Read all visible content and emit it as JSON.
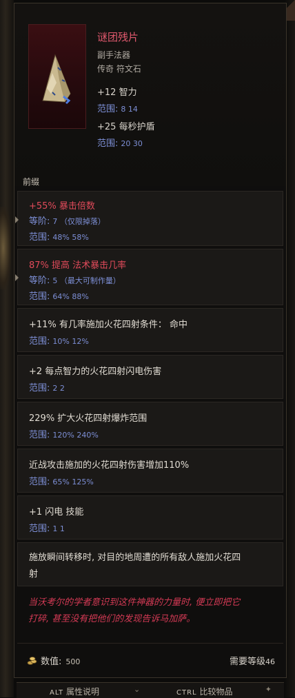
{
  "item": {
    "name": "谜团残片",
    "type": "副手法器",
    "rarity": "传奇 符文石",
    "base_stats": [
      {
        "text": "+12 智力",
        "range_label": "范围:",
        "range": "8 14"
      },
      {
        "text": "+25 每秒护盾",
        "range_label": "范围:",
        "range": "20 30"
      }
    ]
  },
  "prefix_label": "前缀",
  "affixes": [
    {
      "line1": "+55% 暴击倍数",
      "line2_label": "等阶:",
      "line2": "7 （仅限掉落）",
      "range_label": "范围:",
      "range": "48% 58%"
    },
    {
      "line1": "87% 提高 法术暴击几率",
      "line2_label": "等阶:",
      "line2": "5 （最大可制作量）",
      "range_label": "范围:",
      "range": "64% 88%"
    },
    {
      "line1": "+11% 有几率施加火花四射条件： 命中",
      "range_label": "范围:",
      "range": "10% 12%"
    },
    {
      "line1": "+2 每点智力的火花四射闪电伤害",
      "range_label": "范围:",
      "range": "2 2"
    },
    {
      "line1": "229% 扩大火花四射爆炸范围",
      "range_label": "范围:",
      "range": "120% 240%"
    },
    {
      "line1": "近战攻击施加的火花四射伤害增加110%",
      "range_label": "范围:",
      "range": "65% 125%"
    },
    {
      "line1": "+1 闪电 技能",
      "range_label": "范围:",
      "range": "1 1"
    },
    {
      "line1": "施放瞬间转移时, 对目的地周遭的所有敌人施加火花四",
      "line1b": "射"
    }
  ],
  "flavor": {
    "line1": "当沃考尔的学者意识到这件神器的力量时, 便立即把它",
    "line2": "打碎, 甚至没有把他们的发现告诉马加萨。"
  },
  "footer": {
    "value_label": "数值:",
    "value": "500",
    "req_label": "需要等级",
    "req_level": "46"
  },
  "bottom_bar": {
    "alt_key": "ALT",
    "alt_label": "属性说明",
    "ctrl_key": "CTRL",
    "ctrl_label": "比较物品"
  },
  "colors": {
    "name": "#e35a6f",
    "affix_red": "#e04a5a",
    "range_blue": "#7d8fd6",
    "flavor": "#d43a55"
  }
}
